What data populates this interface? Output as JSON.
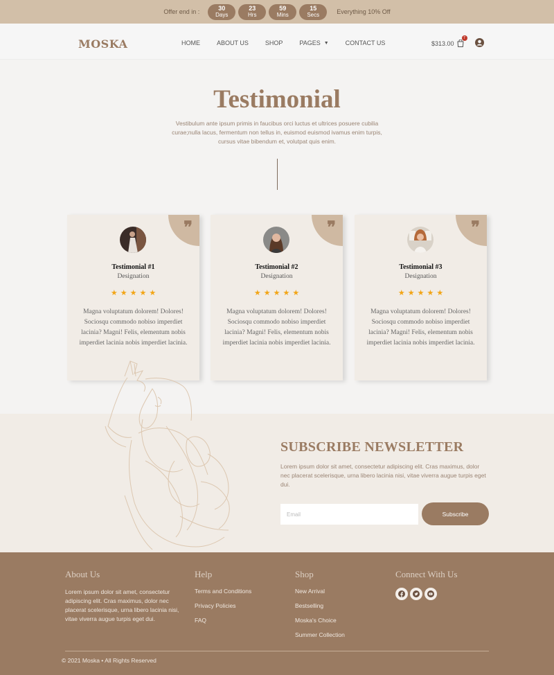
{
  "topbar": {
    "offer_label": "Offer end in :",
    "countdown": [
      {
        "value": "30",
        "unit": "Days"
      },
      {
        "value": "23",
        "unit": "Hrs"
      },
      {
        "value": "59",
        "unit": "Mins"
      },
      {
        "value": "15",
        "unit": "Secs"
      }
    ],
    "deal_text": "Everything 10% Off"
  },
  "header": {
    "logo": "MOSKA",
    "nav": [
      {
        "label": "HOME"
      },
      {
        "label": "ABOUT US"
      },
      {
        "label": "SHOP"
      },
      {
        "label": "PAGES",
        "has_dropdown": true
      },
      {
        "label": "CONTACT US"
      }
    ],
    "cart_total": "$313.00",
    "cart_count": "7",
    "cart_icon": "shopping-bag-icon",
    "user_icon": "user-circle-icon"
  },
  "hero": {
    "title": "Testimonial",
    "intro": "Vestibulum ante ipsum primis in faucibus orci luctus et ultrices posuere cubilia curae;nulla lacus, fermentum non tellus in, euismod euismod ivamus enim turpis, cursus vitae bibendum et, volutpat quis enim."
  },
  "testimonials": [
    {
      "name": "Testimonial #1",
      "designation": "Designation",
      "rating": 5,
      "text": "Magna voluptatum dolorem! Dolores! Sociosqu commodo nobiso imperdiet lacinia? Magni! Felis, elementum nobis imperdiet lacinia nobis imperdiet lacinia."
    },
    {
      "name": "Testimonial #2",
      "designation": "Designation",
      "rating": 5,
      "text": "Magna voluptatum dolorem! Dolores! Sociosqu commodo nobiso imperdiet lacinia? Magni! Felis, elementum nobis imperdiet lacinia nobis imperdiet lacinia."
    },
    {
      "name": "Testimonial #3",
      "designation": "Designation",
      "rating": 5,
      "text": "Magna voluptatum dolorem! Dolores! Sociosqu commodo nobiso imperdiet lacinia? Magni! Felis, elementum nobis imperdiet lacinia nobis imperdiet lacinia."
    }
  ],
  "newsletter": {
    "title": "SUBSCRIBE NEWSLETTER",
    "text": "Lorem ipsum dolor sit amet, consectetur adipiscing elit. Cras maximus, dolor nec placerat scelerisque, urna libero lacinia nisi, vitae viverra augue turpis eget dui.",
    "email_placeholder": "Email",
    "button": "Subscribe"
  },
  "footer": {
    "about": {
      "title": "About Us",
      "text": "Lorem ipsum dolor sit amet, consectetur adipiscing elit. Cras maximus, dolor nec placerat scelerisque, urna libero lacinia nisi, vitae viverra augue turpis eget dui."
    },
    "help": {
      "title": "Help",
      "links": [
        "Terms and Conditions",
        "Privacy Policies",
        "FAQ"
      ]
    },
    "shop": {
      "title": "Shop",
      "links": [
        "New Arrival",
        "Bestselling",
        "Moska's Choice",
        "Summer Collection"
      ]
    },
    "connect": {
      "title": "Connect With Us",
      "social": [
        "facebook-icon",
        "twitter-icon",
        "youtube-icon"
      ]
    },
    "copyright": "© 2021 Moska • All Rights Reserved"
  },
  "colors": {
    "brand": "#9a7b62",
    "topbar": "#d2bfa8",
    "card": "#f1ece6",
    "star": "#f2a516",
    "badge": "#c0392b"
  }
}
